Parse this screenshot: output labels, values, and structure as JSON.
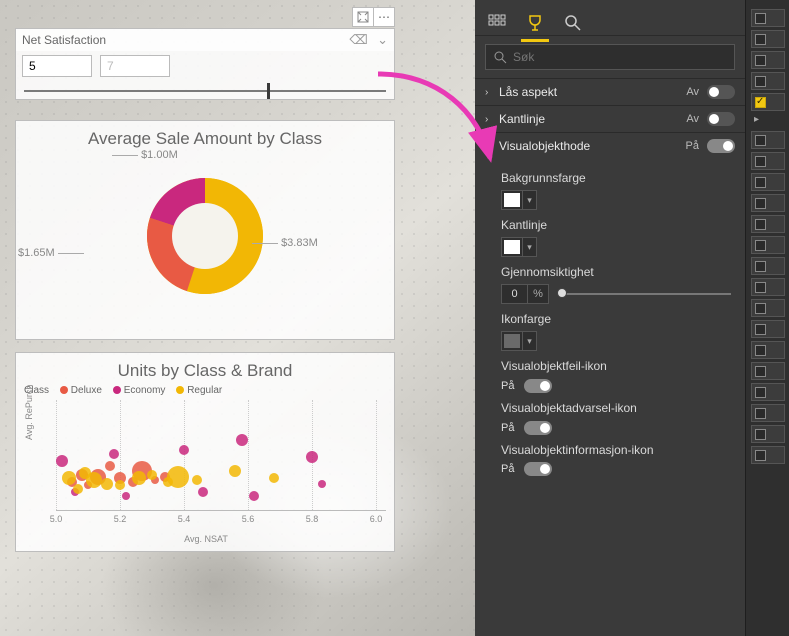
{
  "slicer": {
    "title": "Net Satisfaction",
    "min": "5",
    "max": "7",
    "thumb_pos_pct": 67
  },
  "donut": {
    "title": "Average Sale Amount by Class",
    "labels": {
      "top": "$1.00M",
      "left": "$1.65M",
      "right": "$3.83M"
    }
  },
  "scatter": {
    "title": "Units by Class & Brand",
    "legend_title": "Class",
    "legend": [
      {
        "name": "Deluxe",
        "color": "#e85a44"
      },
      {
        "name": "Economy",
        "color": "#c9287e"
      },
      {
        "name": "Regular",
        "color": "#f2b705"
      }
    ],
    "xlabel": "Avg. NSAT",
    "ylabel": "Avg. RePurch",
    "ticks": [
      "5.0",
      "5.2",
      "5.4",
      "5.6",
      "5.8",
      "6.0"
    ]
  },
  "panel": {
    "search_placeholder": "Søk",
    "sections": {
      "aspect": {
        "label": "Lås aspekt",
        "state": "Av"
      },
      "border": {
        "label": "Kantlinje",
        "state": "Av"
      },
      "header": {
        "label": "Visualobjekthode",
        "state": "På"
      }
    },
    "props": {
      "bgcolor": {
        "label": "Bakgrunnsfarge",
        "swatch": "#ffffff"
      },
      "bordercol": {
        "label": "Kantlinje",
        "swatch": "#ffffff"
      },
      "opacity": {
        "label": "Gjennomsiktighet",
        "value": "0",
        "unit": "%"
      },
      "iconcolor": {
        "label": "Ikonfarge",
        "swatch": "#6a6a6a"
      },
      "err": {
        "label": "Visualobjektfeil-ikon",
        "state": "På"
      },
      "warn": {
        "label": "Visualobjektadvarsel-ikon",
        "state": "På"
      },
      "info": {
        "label": "Visualobjektinformasjon-ikon",
        "state": "På"
      }
    }
  },
  "chart_data": [
    {
      "type": "pie",
      "title": "Average Sale Amount by Class",
      "series": [
        {
          "name": "Deluxe",
          "value": 1.0,
          "color": "#c9287e"
        },
        {
          "name": "Economy",
          "value": 1.65,
          "color": "#e85a44"
        },
        {
          "name": "Regular",
          "value": 3.83,
          "color": "#f2b705"
        }
      ],
      "unit": "$M",
      "donut": true
    },
    {
      "type": "scatter",
      "title": "Units by Class & Brand",
      "xlabel": "Avg. NSAT",
      "ylabel": "Avg. RePurch",
      "xlim": [
        5.0,
        6.0
      ],
      "size_encodes": "Units",
      "series": [
        {
          "name": "Deluxe",
          "color": "#e85a44",
          "points": [
            {
              "x": 5.05,
              "y": 0.46,
              "r": 5
            },
            {
              "x": 5.08,
              "y": 0.5,
              "r": 6
            },
            {
              "x": 5.1,
              "y": 0.44,
              "r": 4
            },
            {
              "x": 5.13,
              "y": 0.49,
              "r": 8
            },
            {
              "x": 5.17,
              "y": 0.55,
              "r": 5
            },
            {
              "x": 5.2,
              "y": 0.48,
              "r": 6
            },
            {
              "x": 5.24,
              "y": 0.46,
              "r": 5
            },
            {
              "x": 5.27,
              "y": 0.52,
              "r": 10
            },
            {
              "x": 5.31,
              "y": 0.47,
              "r": 4
            },
            {
              "x": 5.34,
              "y": 0.49,
              "r": 5
            }
          ]
        },
        {
          "name": "Economy",
          "color": "#c9287e",
          "points": [
            {
              "x": 5.02,
              "y": 0.58,
              "r": 6
            },
            {
              "x": 5.06,
              "y": 0.4,
              "r": 4
            },
            {
              "x": 5.18,
              "y": 0.62,
              "r": 5
            },
            {
              "x": 5.22,
              "y": 0.38,
              "r": 4
            },
            {
              "x": 5.4,
              "y": 0.64,
              "r": 5
            },
            {
              "x": 5.46,
              "y": 0.4,
              "r": 5
            },
            {
              "x": 5.58,
              "y": 0.7,
              "r": 6
            },
            {
              "x": 5.62,
              "y": 0.38,
              "r": 5
            },
            {
              "x": 5.8,
              "y": 0.6,
              "r": 6
            },
            {
              "x": 5.83,
              "y": 0.45,
              "r": 4
            }
          ]
        },
        {
          "name": "Regular",
          "color": "#f2b705",
          "points": [
            {
              "x": 5.04,
              "y": 0.48,
              "r": 7
            },
            {
              "x": 5.07,
              "y": 0.42,
              "r": 5
            },
            {
              "x": 5.09,
              "y": 0.51,
              "r": 6
            },
            {
              "x": 5.12,
              "y": 0.47,
              "r": 8
            },
            {
              "x": 5.16,
              "y": 0.45,
              "r": 6
            },
            {
              "x": 5.2,
              "y": 0.44,
              "r": 5
            },
            {
              "x": 5.26,
              "y": 0.48,
              "r": 7
            },
            {
              "x": 5.3,
              "y": 0.5,
              "r": 5
            },
            {
              "x": 5.35,
              "y": 0.46,
              "r": 5
            },
            {
              "x": 5.38,
              "y": 0.49,
              "r": 11
            },
            {
              "x": 5.44,
              "y": 0.47,
              "r": 5
            },
            {
              "x": 5.56,
              "y": 0.52,
              "r": 6
            },
            {
              "x": 5.68,
              "y": 0.48,
              "r": 5
            }
          ]
        }
      ]
    }
  ]
}
